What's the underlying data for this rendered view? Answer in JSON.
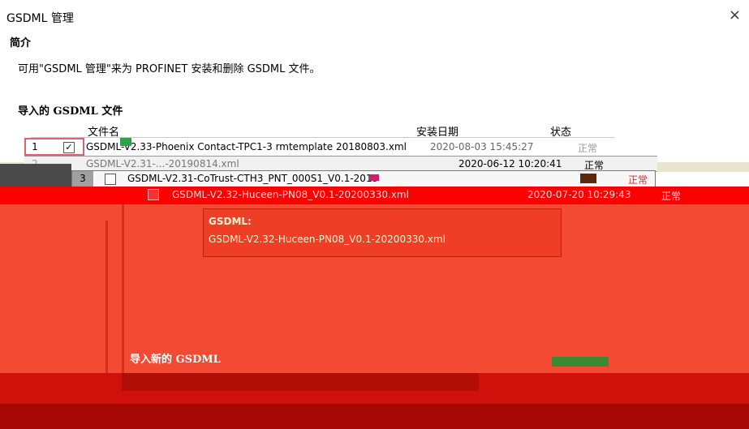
{
  "window": {
    "title": "GSDML 管理",
    "close_glyph": "×"
  },
  "intro": {
    "heading": "简介",
    "text": "可用\"GSDML 管理\"来为 PROFINET 安装和删除 GSDML 文件。"
  },
  "imported": {
    "heading": "导入的 GSDML 文件",
    "columns": {
      "file": "文件名",
      "date": "安装日期",
      "status": "状态"
    },
    "rows": [
      {
        "index": "1",
        "checked": "✓",
        "file": "GSDML-V2.33-Phoenix Contact-TPC1-3 rmtemplate 20180803.xml",
        "date": "2020-08-03 15:45:27",
        "status": "正常"
      },
      {
        "index": "2",
        "file": "GSDML-V2.31-...-20190814.xml",
        "date": "2020-06-12 10:20:41",
        "status": "正常"
      },
      {
        "index": "3",
        "file": "GSDML-V2.31-CoTrust-CTH3_PNT_000S1_V0.1-2019",
        "date": "",
        "status": "正常"
      },
      {
        "file": "GSDML-V2.32-Huceen-PN08_V0.1-20200330.xml",
        "date": "2020-07-20 10:29:43",
        "status": "正常"
      }
    ]
  },
  "tooltip": {
    "label": "GSDML:",
    "value": "GSDML-V2.32-Huceen-PN08_V0.1-20200330.xml"
  },
  "import_new": {
    "heading": "导入新的 GSDML"
  }
}
